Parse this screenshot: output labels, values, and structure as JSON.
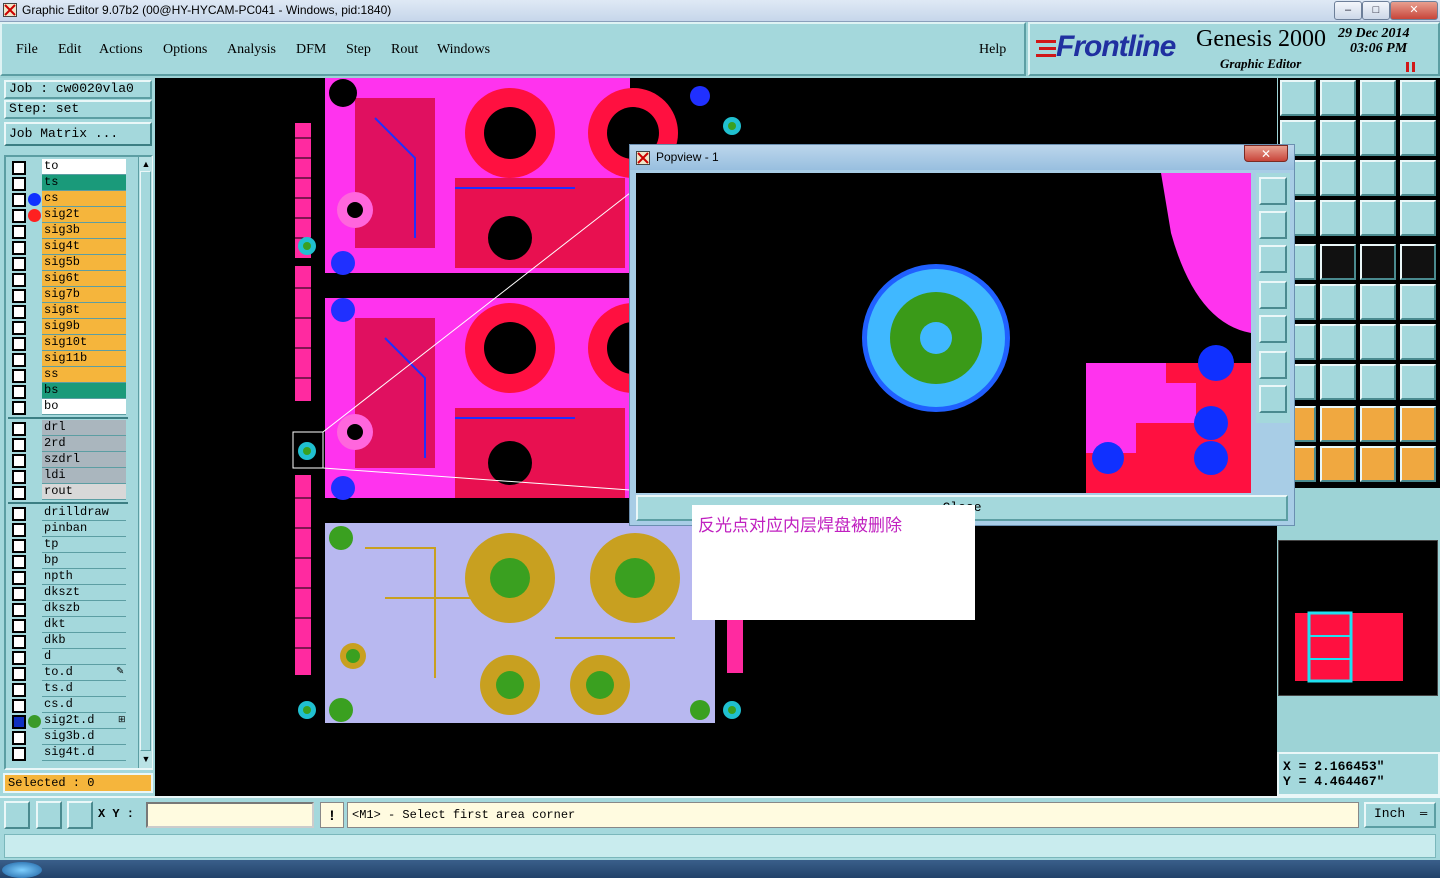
{
  "window": {
    "title": "Graphic Editor 9.07b2 (00@HY-HYCAM-PC041 - Windows, pid:1840)",
    "minimize": "–",
    "maximize": "□",
    "close": "✕"
  },
  "menu": {
    "items": [
      "File",
      "Edit",
      "Actions",
      "Options",
      "Analysis",
      "DFM",
      "Step",
      "Rout",
      "Windows"
    ],
    "help": "Help"
  },
  "brand": {
    "logo": "Frontline",
    "product": "Genesis 2000",
    "subtitle": "Graphic Editor",
    "date": "29 Dec 2014",
    "time": "03:06 PM",
    "pause_icon": "pause-icon"
  },
  "job": {
    "job_label": "Job : cw0020vla0",
    "step_label": "Step: set",
    "matrix_button": "Job Matrix ..."
  },
  "layers": [
    {
      "name": "to",
      "color": "#ffffff",
      "dot": ""
    },
    {
      "name": "ts",
      "color": "#1a9a7a",
      "dot": ""
    },
    {
      "name": "cs",
      "color": "#f5b53c",
      "dot": "#1030ff"
    },
    {
      "name": "sig2t",
      "color": "#f5b53c",
      "dot": "#ff2020"
    },
    {
      "name": "sig3b",
      "color": "#f5b53c",
      "dot": ""
    },
    {
      "name": "sig4t",
      "color": "#f5b53c",
      "dot": ""
    },
    {
      "name": "sig5b",
      "color": "#f5b53c",
      "dot": ""
    },
    {
      "name": "sig6t",
      "color": "#f5b53c",
      "dot": ""
    },
    {
      "name": "sig7b",
      "color": "#f5b53c",
      "dot": ""
    },
    {
      "name": "sig8t",
      "color": "#f5b53c",
      "dot": ""
    },
    {
      "name": "sig9b",
      "color": "#f5b53c",
      "dot": ""
    },
    {
      "name": "sig10t",
      "color": "#f5b53c",
      "dot": ""
    },
    {
      "name": "sig11b",
      "color": "#f5b53c",
      "dot": ""
    },
    {
      "name": "ss",
      "color": "#f5b53c",
      "dot": ""
    },
    {
      "name": "bs",
      "color": "#1a9a7a",
      "dot": ""
    },
    {
      "name": "bo",
      "color": "#ffffff",
      "dot": ""
    }
  ],
  "drill_layers": [
    {
      "name": "drl",
      "color": "#aab6be"
    },
    {
      "name": "2rd",
      "color": "#aab6be"
    },
    {
      "name": "szdrl",
      "color": "#aab6be"
    },
    {
      "name": "ldi",
      "color": "#aab6be"
    },
    {
      "name": "rout",
      "color": "#d8d8d8"
    }
  ],
  "misc_layers": [
    {
      "name": "drilldraw",
      "dot": ""
    },
    {
      "name": "pinban",
      "dot": ""
    },
    {
      "name": "tp",
      "dot": ""
    },
    {
      "name": "bp",
      "dot": ""
    },
    {
      "name": "npth",
      "dot": ""
    },
    {
      "name": "dkszt",
      "dot": ""
    },
    {
      "name": "dkszb",
      "dot": ""
    },
    {
      "name": "dkt",
      "dot": ""
    },
    {
      "name": "dkb",
      "dot": ""
    },
    {
      "name": "d",
      "dot": ""
    },
    {
      "name": "to.d",
      "dot": ""
    },
    {
      "name": "ts.d",
      "dot": ""
    },
    {
      "name": "cs.d",
      "dot": ""
    },
    {
      "name": "sig2t.d",
      "dot": "#3a9a2a"
    },
    {
      "name": "sig3b.d",
      "dot": ""
    },
    {
      "name": "sig4t.d",
      "dot": ""
    }
  ],
  "selected": "Selected : 0",
  "popview": {
    "title": "Popview - 1",
    "close": "✕",
    "close_button": "Close"
  },
  "annotation": "反光点对应内层焊盘被删除",
  "coords": {
    "x": "X = 2.166453\"",
    "y": "Y = 4.464467\""
  },
  "status": {
    "xy_label": "X Y :",
    "xy_value": "",
    "prompt": "<M1> - Select first area corner",
    "units": "Inch"
  }
}
